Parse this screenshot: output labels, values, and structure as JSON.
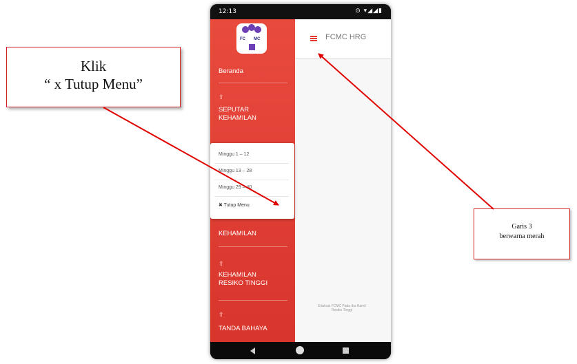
{
  "status_bar": {
    "time": "12:13",
    "icons": "⊙ ▾◢◢▮"
  },
  "app_bar": {
    "title": "FCMC HRG"
  },
  "logo": {
    "text_left": "FC",
    "text_right": "MC"
  },
  "drawer": {
    "items": [
      {
        "label": "Beranda"
      },
      {
        "label": "SEPUTAR\nKEHAMILAN"
      },
      {
        "label": "KEHAMILAN"
      },
      {
        "label": "KEHAMILAN\nRESIKO TINGGI"
      },
      {
        "label": "TANDA BAHAYA"
      }
    ],
    "arrow_glyph": "⇧"
  },
  "popup": {
    "items": [
      {
        "label": "Minggu 1 – 12"
      },
      {
        "label": "Minggu 13 – 28"
      },
      {
        "label": "Minggu 29 – 40"
      },
      {
        "label": "✖ Tutup Menu"
      }
    ]
  },
  "footer": {
    "text": "Edukasi FCMC Pada Ibu Hamil Resiko Tinggi"
  },
  "callout_left": {
    "line1": "Klik",
    "line2": "“ x Tutup Menu”"
  },
  "callout_right": {
    "line1": "Garis 3",
    "line2": "berwarna merah"
  },
  "colors": {
    "drawer": "#e53a30",
    "accent": "#e53a30",
    "callout_border": "#d42020"
  }
}
